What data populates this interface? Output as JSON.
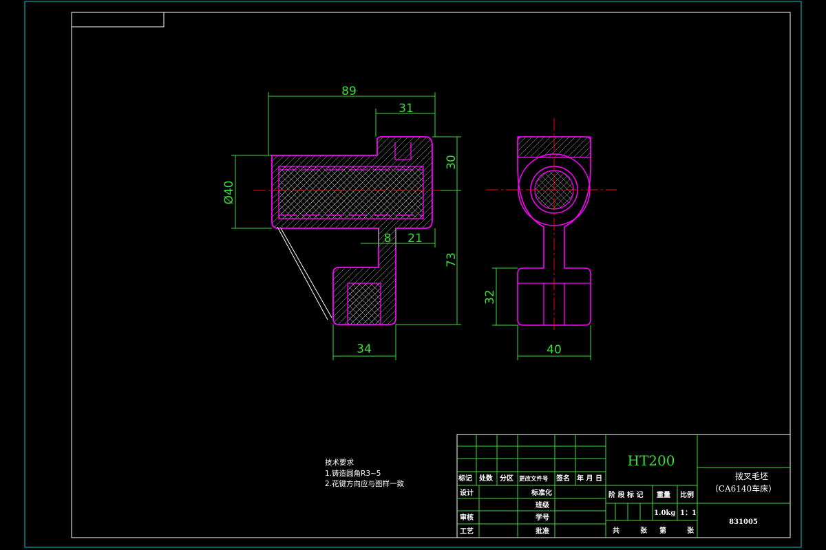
{
  "dimensions": {
    "overall_length": "89",
    "top_step_length": "31",
    "bore_diameter": "Ø40",
    "top_height": "30",
    "lower_height": "73",
    "slot_width": "8",
    "right_offset": "21",
    "foot_width": "34",
    "side_foot_height": "32",
    "side_width": "40"
  },
  "notes": {
    "heading": "技术要求",
    "line1": "1.铸造圆角R3~5",
    "line2": "2.花键方向应与图样一致"
  },
  "title_block": {
    "material": "HT200",
    "part_name": "拨叉毛坯",
    "part_subtitle": "（CA6140车床）",
    "drawing_number": "831005",
    "weight": "1.0kg",
    "scale": "1：1",
    "labels": {
      "mark": "标记",
      "count": "处数",
      "zone": "分区",
      "change_doc": "更改文件号",
      "signature": "签名",
      "date": "年 月 日",
      "design": "设计",
      "standardize": "标准化",
      "review": "审核",
      "process": "工艺",
      "stage_mark": "阶 段 标 记",
      "weight_label": "重量",
      "scale_label": "比例",
      "class": "班级",
      "student_no": "学号",
      "approve": "批准",
      "total_sheets": "共",
      "sheets": "张",
      "sheet_no": "第",
      "sheet": "张"
    }
  },
  "colors": {
    "border": "#00c8c8",
    "outline": "#ffffff",
    "part": "#ff00ff",
    "dimension": "#3cdc3c",
    "centerline": "#ff0000"
  }
}
